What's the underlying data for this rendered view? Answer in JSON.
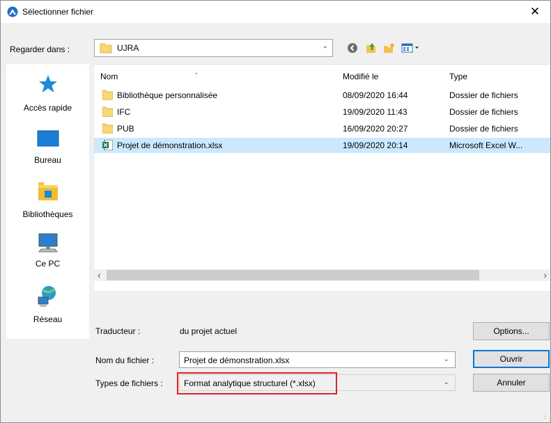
{
  "window": {
    "title": "Sélectionner fichier",
    "close_glyph": "✕"
  },
  "look_in": {
    "label": "Regarder dans :",
    "value": "UJRA"
  },
  "toolbar": {
    "icons": [
      "back-icon",
      "up-folder-icon",
      "new-folder-icon",
      "view-menu-icon"
    ]
  },
  "places": [
    {
      "label": "Accès rapide",
      "icon": "star-icon"
    },
    {
      "label": "Bureau",
      "icon": "desktop-icon"
    },
    {
      "label": "Bibliothèques",
      "icon": "libraries-icon"
    },
    {
      "label": "Ce PC",
      "icon": "computer-icon"
    },
    {
      "label": "Réseau",
      "icon": "network-icon"
    }
  ],
  "columns": {
    "name": "Nom",
    "modified": "Modifié le",
    "type": "Type"
  },
  "files": [
    {
      "name": "Bibliothèque personnalisée",
      "modified": "08/09/2020 16:44",
      "type": "Dossier de fichiers",
      "kind": "folder"
    },
    {
      "name": "IFC",
      "modified": "19/09/2020 11:43",
      "type": "Dossier de fichiers",
      "kind": "folder"
    },
    {
      "name": "PUB",
      "modified": "16/09/2020 20:27",
      "type": "Dossier de fichiers",
      "kind": "folder"
    },
    {
      "name": "Projet de démonstration.xlsx",
      "modified": "19/09/2020 20:14",
      "type": "Microsoft Excel W...",
      "kind": "excel",
      "selected": true
    }
  ],
  "translator": {
    "label": "Traducteur :",
    "value": "du projet actuel",
    "options_button": "Options..."
  },
  "filename": {
    "label": "Nom du fichier :",
    "value": "Projet de démonstration.xlsx"
  },
  "filetype": {
    "label": "Types de fichiers :",
    "value": "Format analytique structurel (*.xlsx)"
  },
  "buttons": {
    "open": "Ouvrir",
    "cancel": "Annuler"
  },
  "colors": {
    "selection": "#cce8ff",
    "highlight_box": "#e0202a",
    "accent": "#0078d7"
  }
}
